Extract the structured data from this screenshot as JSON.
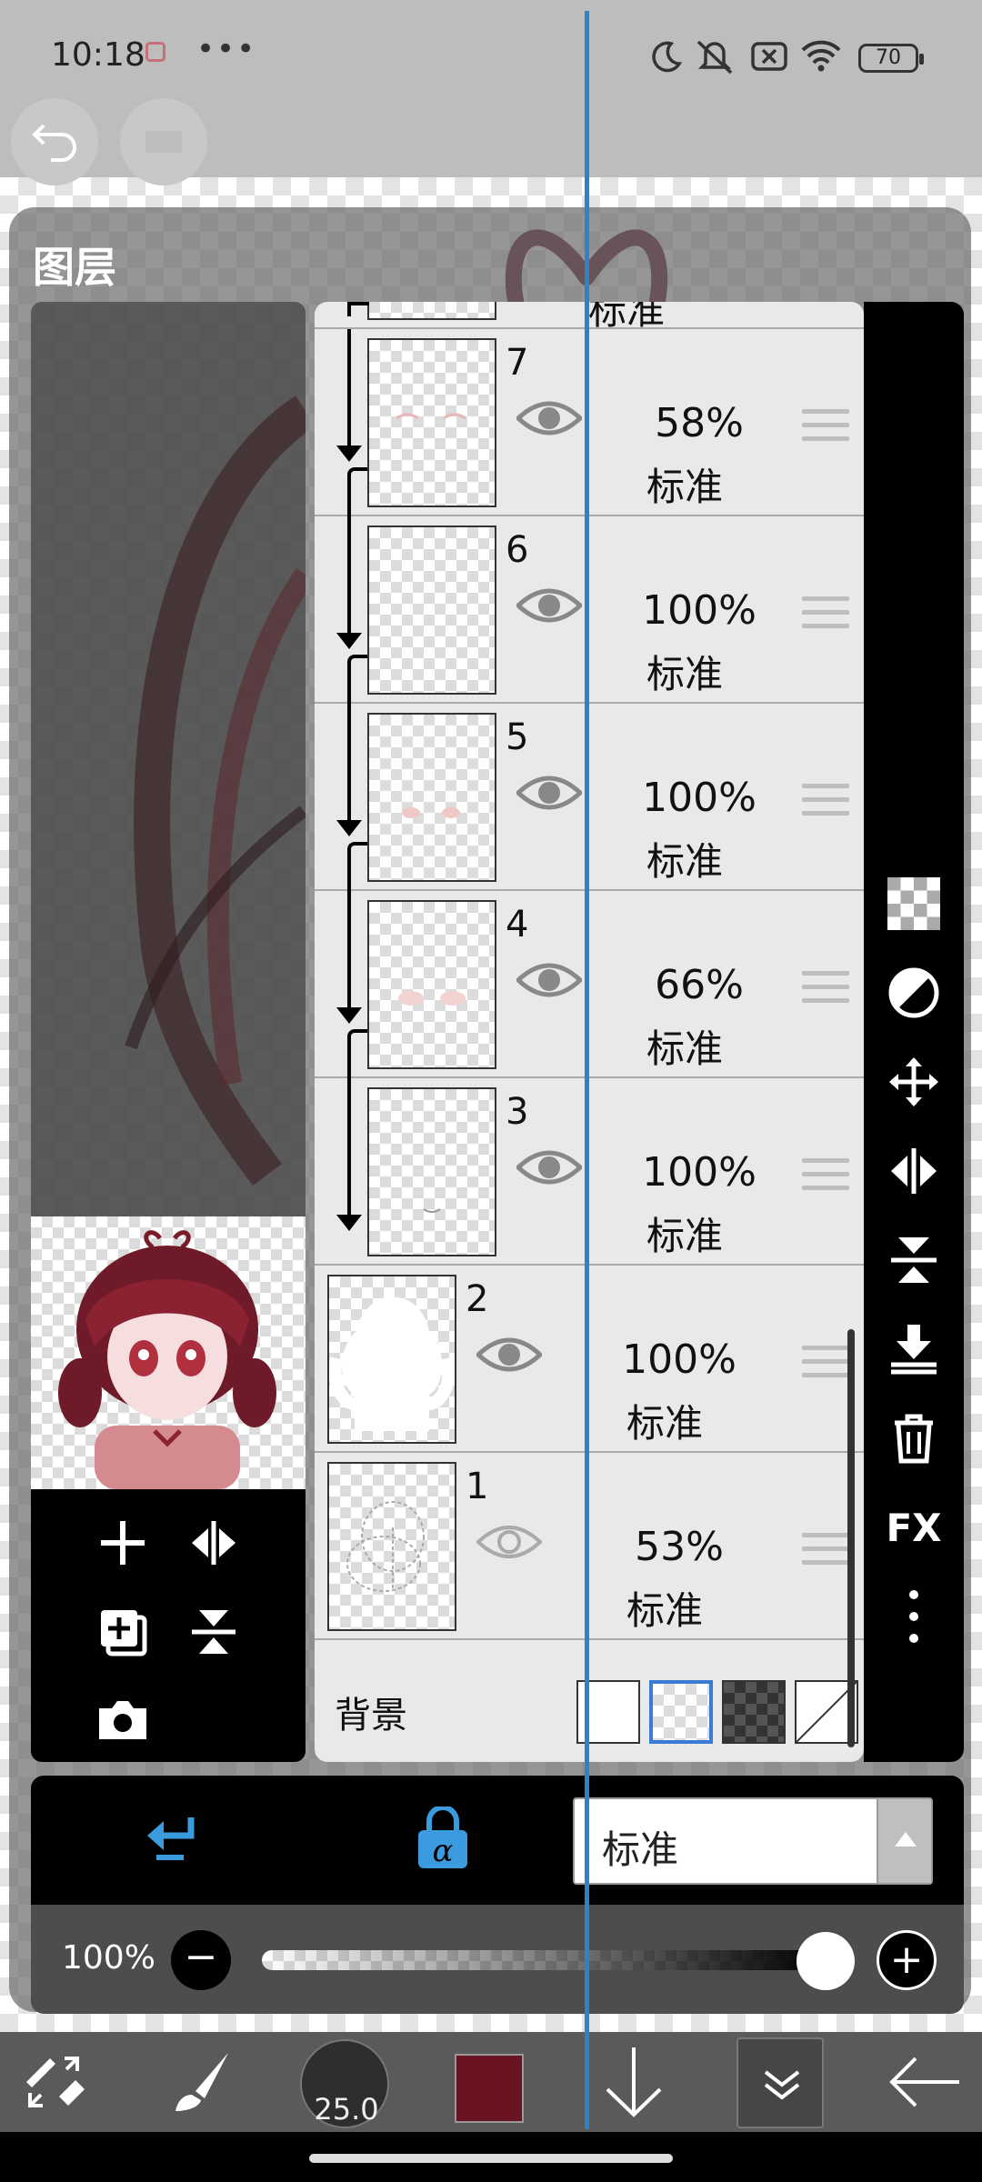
{
  "status_bar": {
    "time": "10:18",
    "more": "•••",
    "battery": "70"
  },
  "panel": {
    "title": "图层"
  },
  "layers": [
    {
      "number": "7",
      "opacity": "58%",
      "mode": "标准",
      "clipped": true
    },
    {
      "number": "6",
      "opacity": "100%",
      "mode": "标准",
      "clipped": true
    },
    {
      "number": "5",
      "opacity": "100%",
      "mode": "标准",
      "clipped": true
    },
    {
      "number": "4",
      "opacity": "66%",
      "mode": "标准",
      "clipped": true
    },
    {
      "number": "3",
      "opacity": "100%",
      "mode": "标准",
      "clipped": true
    },
    {
      "number": "2",
      "opacity": "100%",
      "mode": "标准",
      "clipped": false
    },
    {
      "number": "1",
      "opacity": "53%",
      "mode": "标准",
      "clipped": false
    }
  ],
  "top_partial_layer": {
    "mode": "标准"
  },
  "background": {
    "label": "背景",
    "options": [
      "white",
      "transparent",
      "dark-checker",
      "none"
    ],
    "selected": "transparent"
  },
  "blend": {
    "mode": "标准"
  },
  "opacity": {
    "label": "100%",
    "value": 1.0,
    "minus": "−",
    "plus": "+"
  },
  "right_tools": {
    "fx_label": "FX"
  },
  "bottom_bar": {
    "brush_size": "25.0",
    "color": "#6b1421"
  }
}
